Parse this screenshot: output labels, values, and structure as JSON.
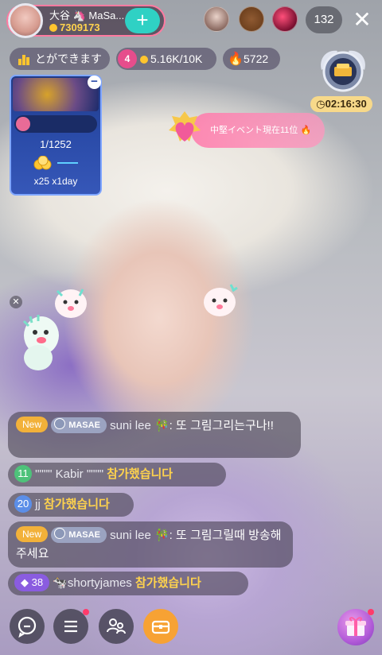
{
  "host": {
    "name": "大谷 🦄 MaSa...",
    "coins": "7309173",
    "follow_label": "+"
  },
  "viewers": {
    "count": "132"
  },
  "close_label": "✕",
  "stats": {
    "rank_chip": "とができます",
    "star_level": "4",
    "star_value": "5.16K/10K",
    "fire_value": "5722"
  },
  "rank_timer": "02:16:30",
  "event_card": {
    "rank": "1/1252",
    "reward": "x25  x1day",
    "minus": "−"
  },
  "mid_banner": {
    "text": "中堅イベント現在11位 🔥"
  },
  "sticker_close": "✕",
  "chat": [
    {
      "badge": "New",
      "tag": "MASAE",
      "user": "suni lee 🎋",
      "text": ": 또 그림그리는구나!!"
    },
    {
      "level": "11",
      "user": "\"\"\"\" Kabir \"\"\"\"",
      "text": "참가했습니다"
    },
    {
      "level": "20",
      "user": "jj",
      "text": "참가했습니다"
    },
    {
      "badge": "New",
      "tag": "MASAE",
      "user": "suni lee 🎋",
      "text": ": 또 그림그릴때 방송해주세요"
    },
    {
      "level": "38",
      "user": "🐄shortyjames",
      "text": "참가했습니다"
    }
  ],
  "colors": {
    "accent_pink": "#ff7aa0",
    "follow_teal": "#2fd1c4",
    "joined_yellow": "#ffd34d",
    "new_orange": "#f2b13a"
  }
}
